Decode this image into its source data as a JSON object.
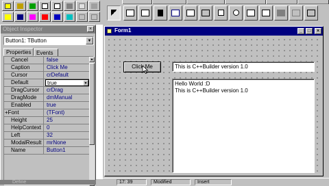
{
  "object_inspector": {
    "title": "Object Inspector",
    "close_label": "×",
    "selected_object": "Button1: TButton",
    "tabs": [
      {
        "label": "Properties"
      },
      {
        "label": "Events"
      }
    ],
    "properties": [
      {
        "name": "Cancel",
        "value": "false"
      },
      {
        "name": "Caption",
        "value": "Click Me"
      },
      {
        "name": "Cursor",
        "value": "crDefault"
      },
      {
        "name": "Default",
        "value": "true"
      },
      {
        "name": "DragCursor",
        "value": "crDrag"
      },
      {
        "name": "DragMode",
        "value": "dmManual"
      },
      {
        "name": "Enabled",
        "value": "true"
      },
      {
        "name": "+Font",
        "value": "(TFont)"
      },
      {
        "name": "Height",
        "value": "25"
      },
      {
        "name": "HelpContext",
        "value": "0"
      },
      {
        "name": "Left",
        "value": "32"
      },
      {
        "name": "ModalResult",
        "value": "mrNone"
      },
      {
        "name": "Name",
        "value": "Button1"
      }
    ],
    "status_text": "Define"
  },
  "form": {
    "title": "Form1",
    "button_caption": "Click Me",
    "edit_text": "This is C++Builder version 1.0",
    "memo_lines": [
      "Hello World :D",
      "This is C++Builder version 1.0"
    ]
  },
  "editor_status": {
    "position": "17: 39",
    "modified": "Modified",
    "mode": "Insert"
  },
  "colors": {
    "title_active": "#000080",
    "title_inactive": "#808080",
    "face": "#c0c0c0",
    "value_text": "#000080"
  }
}
